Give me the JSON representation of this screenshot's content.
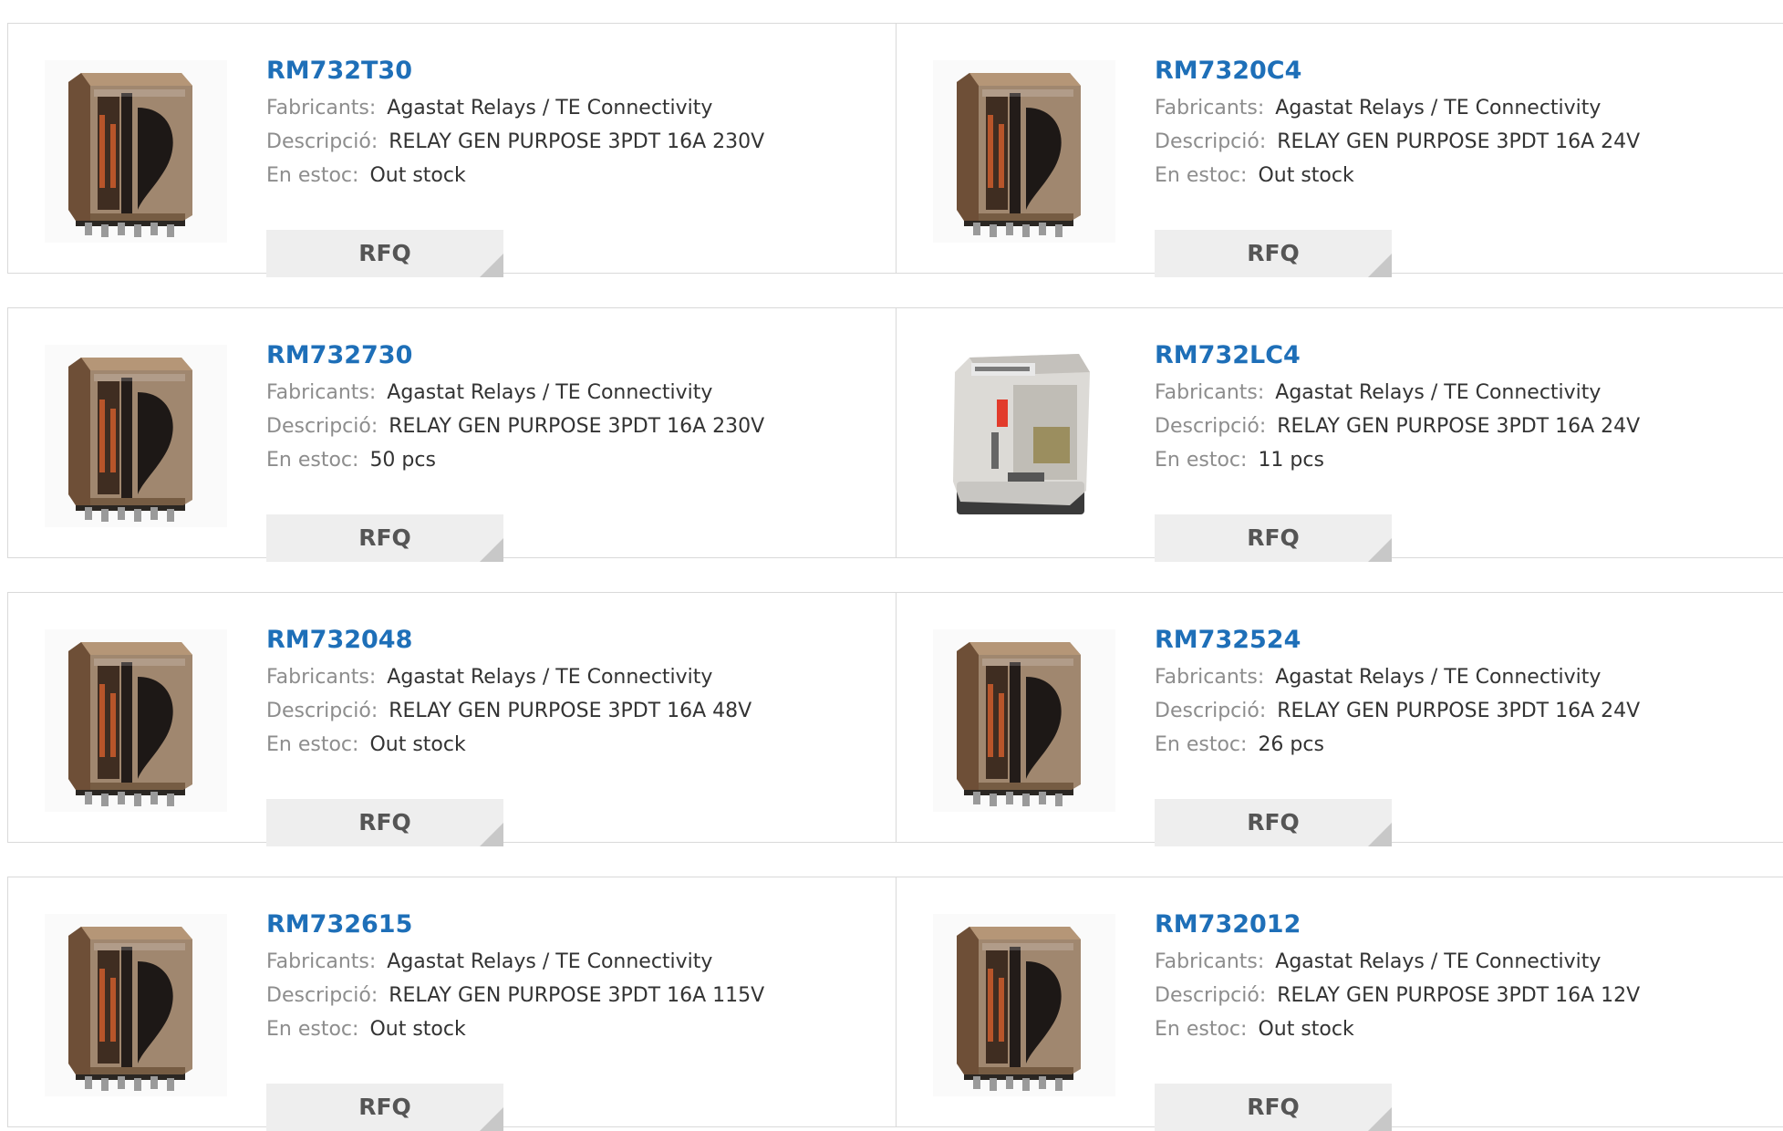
{
  "labels": {
    "manufacturer": "Fabricants:",
    "description": "Descripció:",
    "stock": "En estoc:",
    "rfq": "RFQ"
  },
  "colors": {
    "link": "#1e6fb8",
    "label": "#8d8d8d",
    "value": "#333333",
    "border": "#d9d9d9",
    "button_bg": "#eeeeee",
    "button_corner": "#c8c8c8"
  },
  "products": [
    {
      "part": "RM732T30",
      "manufacturer": "Agastat Relays / TE Connectivity",
      "description": "RELAY GEN PURPOSE 3PDT 16A 230V",
      "stock": "Out stock",
      "image_icon": "relay-amber-icon"
    },
    {
      "part": "RM7320C4",
      "manufacturer": "Agastat Relays / TE Connectivity",
      "description": "RELAY GEN PURPOSE 3PDT 16A 24V",
      "stock": "Out stock",
      "image_icon": "relay-amber-icon"
    },
    {
      "part": "RM732730",
      "manufacturer": "Agastat Relays / TE Connectivity",
      "description": "RELAY GEN PURPOSE 3PDT 16A 230V",
      "stock": "50 pcs",
      "image_icon": "relay-amber-icon"
    },
    {
      "part": "RM732LC4",
      "manufacturer": "Agastat Relays / TE Connectivity",
      "description": "RELAY GEN PURPOSE 3PDT 16A 24V",
      "stock": "11 pcs",
      "image_icon": "relay-clear-icon"
    },
    {
      "part": "RM732048",
      "manufacturer": "Agastat Relays / TE Connectivity",
      "description": "RELAY GEN PURPOSE 3PDT 16A 48V",
      "stock": "Out stock",
      "image_icon": "relay-amber-icon"
    },
    {
      "part": "RM732524",
      "manufacturer": "Agastat Relays / TE Connectivity",
      "description": "RELAY GEN PURPOSE 3PDT 16A 24V",
      "stock": "26 pcs",
      "image_icon": "relay-amber-icon"
    },
    {
      "part": "RM732615",
      "manufacturer": "Agastat Relays / TE Connectivity",
      "description": "RELAY GEN PURPOSE 3PDT 16A 115V",
      "stock": "Out stock",
      "image_icon": "relay-amber-icon"
    },
    {
      "part": "RM732012",
      "manufacturer": "Agastat Relays / TE Connectivity",
      "description": "RELAY GEN PURPOSE 3PDT 16A 12V",
      "stock": "Out stock",
      "image_icon": "relay-amber-icon"
    }
  ]
}
